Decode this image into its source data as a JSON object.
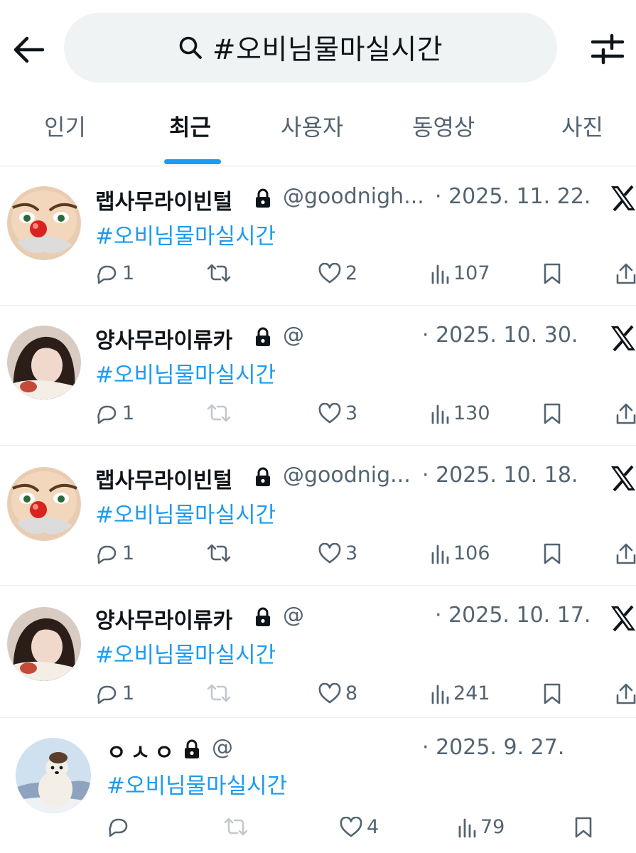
{
  "search": {
    "query": "#오비님물마실시간"
  },
  "tabs": [
    {
      "label": "인기"
    },
    {
      "label": "최근"
    },
    {
      "label": "사용자"
    },
    {
      "label": "동영상"
    },
    {
      "label": "사진"
    }
  ],
  "active_tab": "최근",
  "colors": {
    "accent": "#1d9bf0",
    "muted": "#536471",
    "text": "#0f1419",
    "search_bg": "#eff3f4"
  },
  "posts": [
    {
      "name": "랩사무라이빈털",
      "handle": "@goodnigh...",
      "date": "· 2025. 11. 22.",
      "text": "#오비님물마실시간",
      "replies": "1",
      "reposts": "",
      "likes": "2",
      "views": "107"
    },
    {
      "name": "양사무라이류카",
      "handle": "@",
      "date": "· 2025. 10. 30.",
      "text": "#오비님물마실시간",
      "replies": "1",
      "reposts": "",
      "likes": "3",
      "views": "130"
    },
    {
      "name": "랩사무라이빈털",
      "handle": "@goodnig...",
      "date": "· 2025. 10. 18.",
      "text": "#오비님물마실시간",
      "replies": "1",
      "reposts": "",
      "likes": "3",
      "views": "106"
    },
    {
      "name": "양사무라이류카",
      "handle": "@",
      "date": "· 2025. 10. 17.",
      "text": "#오비님물마실시간",
      "replies": "1",
      "reposts": "",
      "likes": "8",
      "views": "241"
    },
    {
      "name": "ㅇㅅㅇ",
      "handle": "@",
      "date": "· 2025. 9. 27.",
      "text": "#오비님물마실시간",
      "replies": "",
      "reposts": "",
      "likes": "4",
      "views": "79"
    }
  ]
}
